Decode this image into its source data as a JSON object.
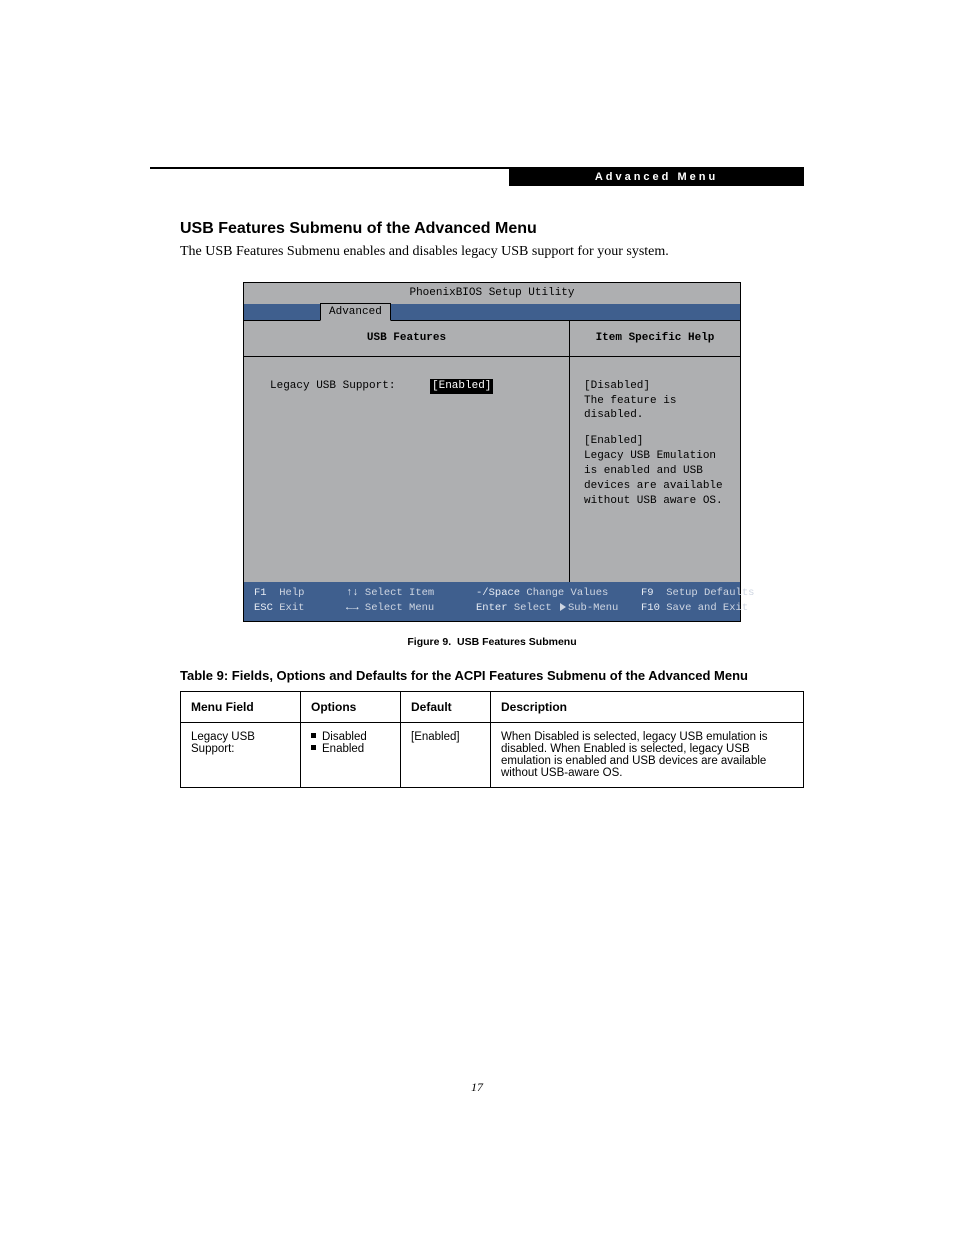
{
  "header_bar": "Advanced Menu",
  "section": {
    "title": "USB Features Submenu of the Advanced Menu",
    "desc": "The USB Features Submenu enables and disables legacy USB support for your system."
  },
  "bios": {
    "title": "PhoenixBIOS Setup Utility",
    "tab": "Advanced",
    "left_heading": "USB Features",
    "right_heading": "Item Specific Help",
    "setting_label": "Legacy USB Support:",
    "setting_value": "[Enabled]",
    "help": {
      "l1": "[Disabled]",
      "l2": "The feature is disabled.",
      "l3": "[Enabled]",
      "l4": "Legacy USB Emulation",
      "l5": "is enabled and USB",
      "l6": "devices are available",
      "l7": "without USB aware OS."
    },
    "footer": {
      "r1c1k": "F1",
      "r1c1t": "Help",
      "r1c2k": "↑↓",
      "r1c2t": "Select Item",
      "r1c3k": "-/Space",
      "r1c3t": "Change Values",
      "r1c4k": "F9",
      "r1c4t": "Setup Defaults",
      "r2c1k": "ESC",
      "r2c1t": "Exit",
      "r2c2k": "←→",
      "r2c2t": "Select Menu",
      "r2c3k": "Enter",
      "r2c3t": "Select",
      "r2c3t2": "Sub-Menu",
      "r2c4k": "F10",
      "r2c4t": "Save and Exit"
    }
  },
  "figure_caption_label": "Figure 9.",
  "figure_caption_text": "USB Features Submenu",
  "table_title": "Table 9: Fields, Options and Defaults for the ACPI Features Submenu of the Advanced Menu",
  "table": {
    "h1": "Menu Field",
    "h2": "Options",
    "h3": "Default",
    "h4": "Description",
    "row": {
      "field": "Legacy USB Support:",
      "opt1": "Disabled",
      "opt2": "Enabled",
      "def": "[Enabled]",
      "desc": "When Disabled is selected, legacy USB emulation is disabled. When Enabled is selected, legacy USB emulation is enabled and USB devices are available without USB-aware OS."
    }
  },
  "page_number": "17"
}
